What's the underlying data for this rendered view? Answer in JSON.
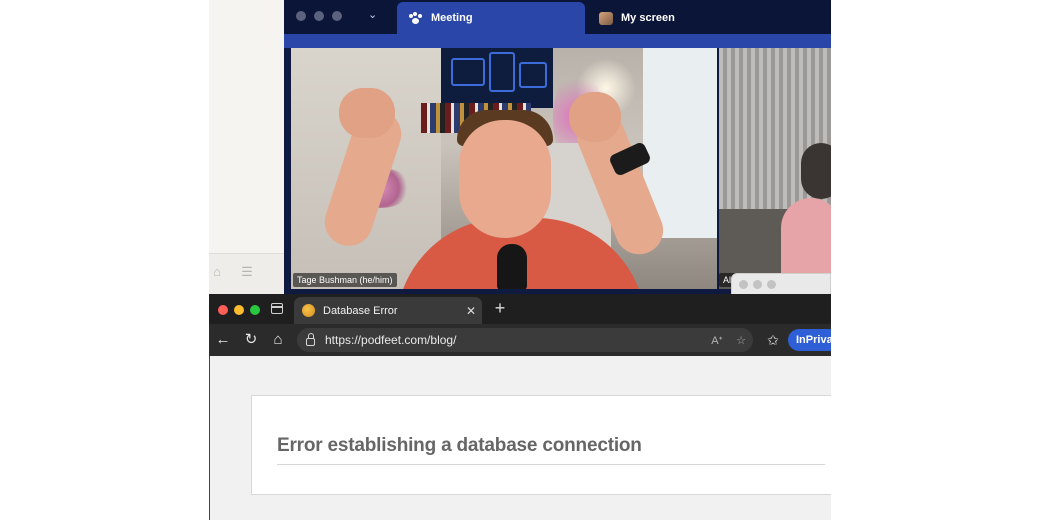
{
  "zoom": {
    "tabs": [
      {
        "label": "Meeting",
        "active": true
      },
      {
        "label": "My screen",
        "active": false
      }
    ],
    "participants": [
      {
        "name": "Tage Bushman (he/him)"
      },
      {
        "name": "All"
      }
    ]
  },
  "browser": {
    "tab": {
      "title": "Database Error"
    },
    "address": {
      "url": "https://podfeet.com/blog/"
    },
    "inprivate_label": "InPrivat"
  },
  "page": {
    "error_heading": "Error establishing a database connection"
  },
  "colors": {
    "zoom_accent": "#2a46a8",
    "inprivate_blue": "#2f5fd6",
    "close": "#ff5f57",
    "minimize": "#febc2e",
    "zoom_green": "#28c840"
  },
  "icons": [
    "tag-icon",
    "list-icon",
    "chevron-down-icon",
    "paw-icon",
    "back-icon",
    "refresh-icon",
    "home-icon",
    "lock-icon",
    "read-aloud-icon",
    "star-icon",
    "favorites-icon",
    "close-icon",
    "plus-icon"
  ]
}
